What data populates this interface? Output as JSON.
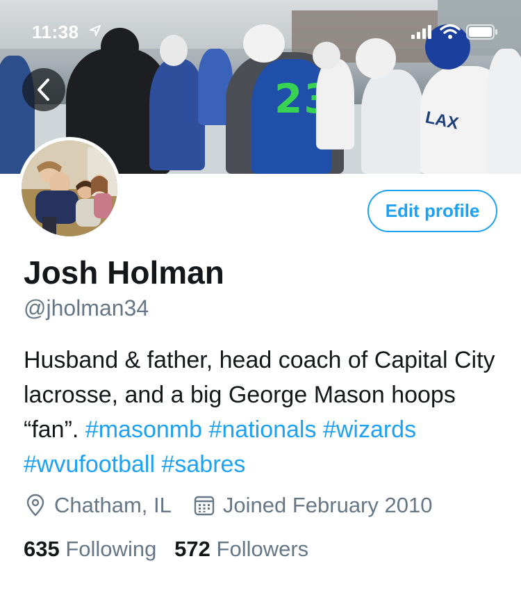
{
  "status_bar": {
    "time": "11:38",
    "icons": [
      "location-arrow-icon",
      "signal-icon",
      "wifi-icon",
      "battery-icon"
    ]
  },
  "header": {
    "back_icon": "chevron-left-icon",
    "jersey_number": "23",
    "jersey_letters": "LAX"
  },
  "profile": {
    "edit_button": "Edit profile",
    "name": "Josh Holman",
    "handle": "@jholman34",
    "bio_text": "Husband & father, head coach of Capital City lacrosse, and a big George Mason hoops “fan”.",
    "hashtags": [
      "#masonmb",
      "#nationals",
      "#wizards",
      "#wvufootball",
      "#sabres"
    ],
    "location": "Chatham, IL",
    "joined": "Joined February 2010",
    "following_count": "635",
    "following_label": "Following",
    "followers_count": "572",
    "followers_label": "Followers"
  },
  "colors": {
    "accent": "#1da1f2",
    "secondary_text": "#657786",
    "primary_text": "#14171a"
  }
}
